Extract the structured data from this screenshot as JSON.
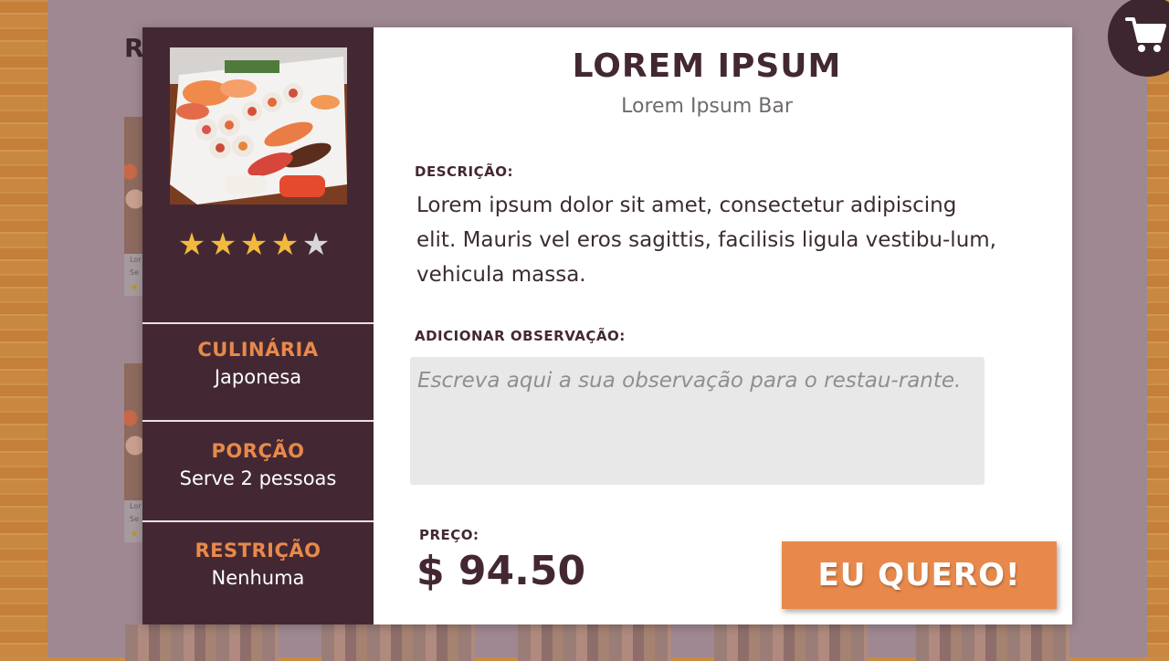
{
  "background": {
    "heading": "R",
    "card_texts": [
      "Lor",
      "Se",
      "Lor",
      "Se"
    ]
  },
  "cart": {
    "icon": "shopping-cart-icon"
  },
  "item": {
    "name": "LOREM IPSUM",
    "restaurant": "Lorem Ipsum Bar",
    "rating": 4,
    "rating_max": 5,
    "description_label": "DESCRIÇÃO:",
    "description": "Lorem ipsum dolor sit amet, consectetur adipiscing elit. Mauris vel eros sagittis, facilisis ligula vestibu-lum, vehicula massa.",
    "observation_label": "ADICIONAR OBSERVAÇÃO:",
    "observation_placeholder": "Escreva aqui a sua observação para o restau-rante.",
    "price_label": "PREÇO:",
    "price": "$ 94.50",
    "cta_label": "EU QUERO!"
  },
  "details": {
    "cuisine_label": "CULINÁRIA",
    "cuisine_value": "Japonesa",
    "portion_label": "PORÇÃO",
    "portion_value": "Serve 2 pessoas",
    "restriction_label": "RESTRIÇÃO",
    "restriction_value": "Nenhuma"
  },
  "colors": {
    "sidebar": "#432834",
    "accent": "#e8894b",
    "star_on": "#f3b93c",
    "star_off": "#d7d7d7"
  }
}
